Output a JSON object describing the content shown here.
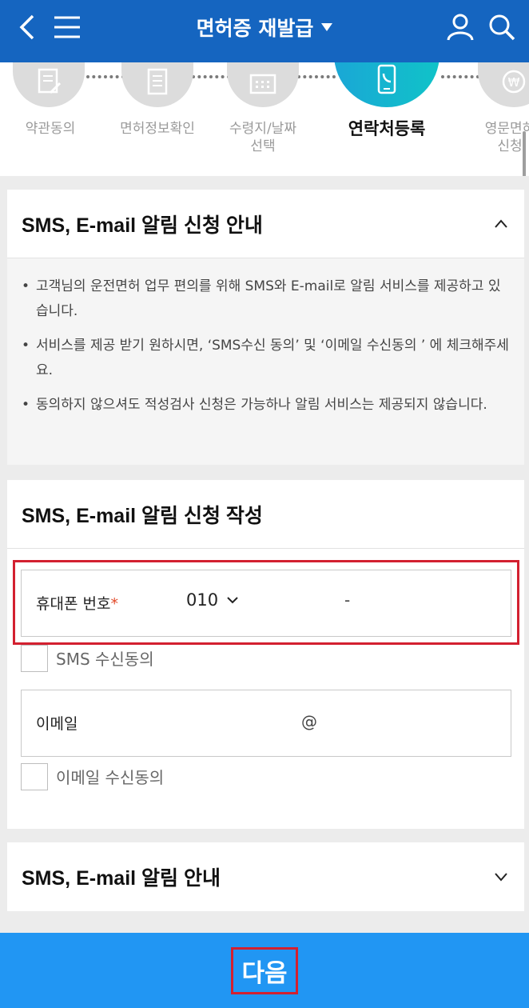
{
  "header": {
    "title": "면허증 재발급",
    "background": "#1565c0"
  },
  "steps": [
    {
      "label": "약관동의",
      "icon": "document-edit-icon",
      "active": false
    },
    {
      "label": "면허정보확인",
      "icon": "document-list-icon",
      "active": false
    },
    {
      "label": "수령지/날짜\n선택",
      "icon": "calendar-icon",
      "active": false
    },
    {
      "label": "연락처등록",
      "icon": "phone-icon",
      "active": true
    },
    {
      "label": "영문면허\n신청",
      "icon": "won-coin-icon",
      "active": false
    }
  ],
  "notice": {
    "title": "SMS, E-mail 알림 신청 안내",
    "items": [
      "고객님의 운전면허 업무 편의를 위해 SMS와 E-mail로 알림 서비스를 제공하고 있습니다.",
      "서비스를 제공 받기 원하시면, ‘SMS수신 동의’ 및 ‘이메일 수신동의 ’ 에 체크해주세요.",
      "동의하지 않으셔도 적성검사 신청은 가능하나 알림 서비스는 제공되지 않습니다."
    ]
  },
  "form": {
    "title": "SMS, E-mail 알림 신청 작성",
    "phone_label": "휴대폰 번호",
    "required_mark": "*",
    "phone_prefix": "010",
    "phone_separator": "-",
    "sms_consent_label": "SMS 수신동의",
    "email_label": "이메일",
    "email_at": "@",
    "email_consent_label": "이메일 수신동의"
  },
  "info": {
    "title": "SMS, E-mail 알림 안내"
  },
  "footer": {
    "next_label": "다음",
    "background": "#2196f3"
  }
}
